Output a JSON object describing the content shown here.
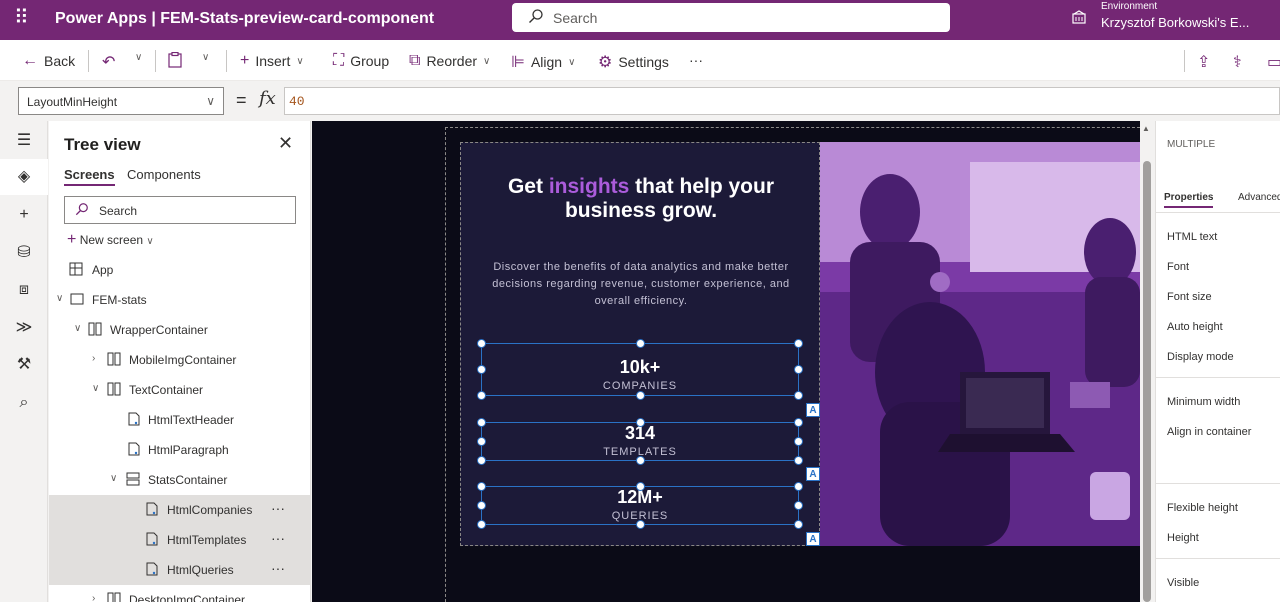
{
  "header": {
    "app_title": "Power Apps | FEM-Stats-preview-card-component",
    "search_placeholder": "Search",
    "environment_label": "Environment",
    "environment_name": "Krzysztof Borkowski's E..."
  },
  "toolbar": {
    "back_label": "Back",
    "insert_label": "Insert",
    "group_label": "Group",
    "reorder_label": "Reorder",
    "align_label": "Align",
    "settings_label": "Settings",
    "more_label": "···"
  },
  "formula_bar": {
    "property": "LayoutMinHeight",
    "equals": "=",
    "fx": "fx",
    "value": "40"
  },
  "tree_view": {
    "title": "Tree view",
    "tabs": [
      "Screens",
      "Components"
    ],
    "search_placeholder": "Search",
    "new_screen_label": "New screen",
    "nodes": [
      {
        "label": "App",
        "icon": "app-icon"
      },
      {
        "label": "FEM-stats",
        "icon": "screen-icon"
      },
      {
        "label": "WrapperContainer",
        "icon": "horizontal-container-icon"
      },
      {
        "label": "MobileImgContainer",
        "icon": "horizontal-container-icon"
      },
      {
        "label": "TextContainer",
        "icon": "horizontal-container-icon"
      },
      {
        "label": "HtmlTextHeader",
        "icon": "html-text-icon"
      },
      {
        "label": "HtmlParagraph",
        "icon": "html-text-icon"
      },
      {
        "label": "StatsContainer",
        "icon": "vertical-container-icon"
      },
      {
        "label": "HtmlCompanies",
        "icon": "html-text-icon"
      },
      {
        "label": "HtmlTemplates",
        "icon": "html-text-icon"
      },
      {
        "label": "HtmlQueries",
        "icon": "html-text-icon"
      },
      {
        "label": "DesktopImgContainer",
        "icon": "horizontal-container-icon"
      }
    ]
  },
  "card": {
    "headline_pre": "Get ",
    "headline_accent": "insights",
    "headline_post": " that help your business grow.",
    "paragraph": "Discover the benefits of data analytics and make better decisions regarding revenue, customer experience, and overall efficiency.",
    "stats": [
      {
        "value": "10k+",
        "label": "COMPANIES"
      },
      {
        "value": "314",
        "label": "TEMPLATES"
      },
      {
        "value": "12M+",
        "label": "QUERIES"
      }
    ],
    "badge": "A",
    "accent_color": "#ab5cdb",
    "bg_color": "#1c1a38"
  },
  "properties_panel": {
    "title": "MULTIPLE",
    "tabs": [
      "Properties",
      "Advanced"
    ],
    "rows": [
      "HTML text",
      "Font",
      "Font size",
      "Auto height",
      "Display mode",
      "Minimum width",
      "Align in container",
      "Flexible height",
      "Height",
      "Visible"
    ]
  },
  "colors": {
    "brand": "#742774",
    "selection": "#2a72c6"
  }
}
